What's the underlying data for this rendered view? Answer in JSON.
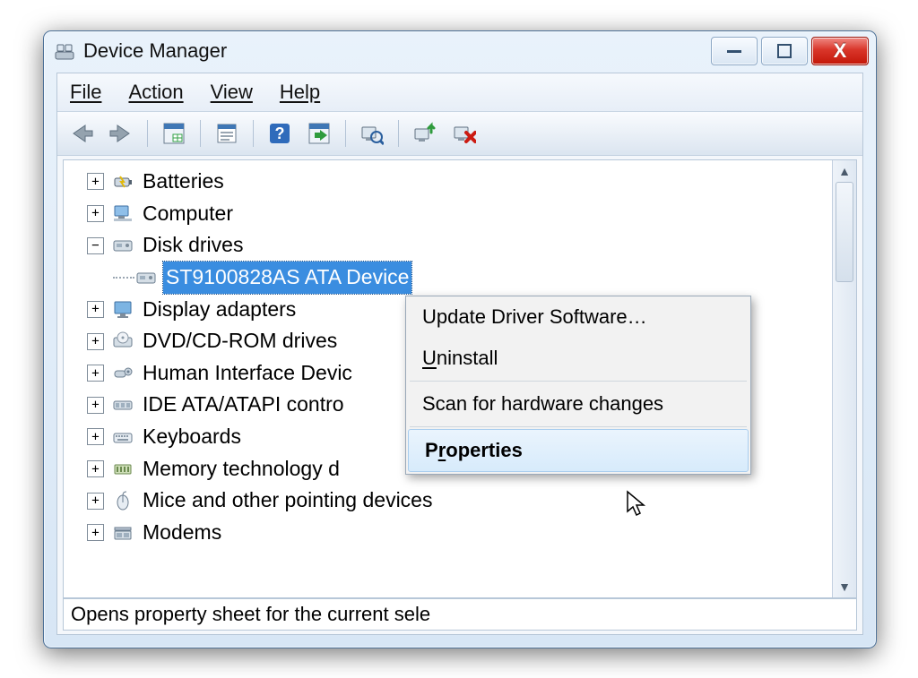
{
  "window": {
    "title": "Device Manager"
  },
  "menubar": {
    "file": "File",
    "action": "Action",
    "view": "View",
    "help": "Help"
  },
  "toolbar": {
    "back": "back-arrow",
    "forward": "forward-arrow",
    "show_hidden": "show-hidden",
    "properties": "properties",
    "help": "help",
    "enable": "enable",
    "scan": "scan-hardware",
    "update": "update-driver",
    "remove": "remove-device"
  },
  "tree": {
    "items": [
      {
        "icon": "battery-icon",
        "label": "Batteries",
        "expandable": "+"
      },
      {
        "icon": "computer-icon",
        "label": "Computer",
        "expandable": "+"
      },
      {
        "icon": "disk-icon",
        "label": "Disk drives",
        "expandable": "-",
        "children": [
          {
            "icon": "disk-icon",
            "label": "ST9100828AS ATA Device",
            "selected": true
          }
        ]
      },
      {
        "icon": "display-icon",
        "label": "Display adapters",
        "expandable": "+"
      },
      {
        "icon": "cdrom-icon",
        "label": "DVD/CD-ROM drives",
        "expandable": "+"
      },
      {
        "icon": "hid-icon",
        "label": "Human Interface Devices",
        "expandable": "+",
        "label_clipped": "Human Interface Devic"
      },
      {
        "icon": "ide-icon",
        "label": "IDE ATA/ATAPI controllers",
        "expandable": "+",
        "label_clipped": "IDE ATA/ATAPI contro"
      },
      {
        "icon": "keyboard-icon",
        "label": "Keyboards",
        "expandable": "+"
      },
      {
        "icon": "memory-icon",
        "label": "Memory technology driver",
        "expandable": "+",
        "label_clipped": "Memory technology d"
      },
      {
        "icon": "mouse-icon",
        "label": "Mice and other pointing devices",
        "expandable": "+"
      },
      {
        "icon": "modem-icon",
        "label": "Modems",
        "expandable": "+"
      }
    ]
  },
  "context_menu": {
    "update": "Update Driver Software…",
    "uninstall": "Uninstall",
    "scan": "Scan for hardware changes",
    "properties": "Properties",
    "highlighted": "properties"
  },
  "statusbar": {
    "text": "Opens property sheet for the current sele"
  }
}
